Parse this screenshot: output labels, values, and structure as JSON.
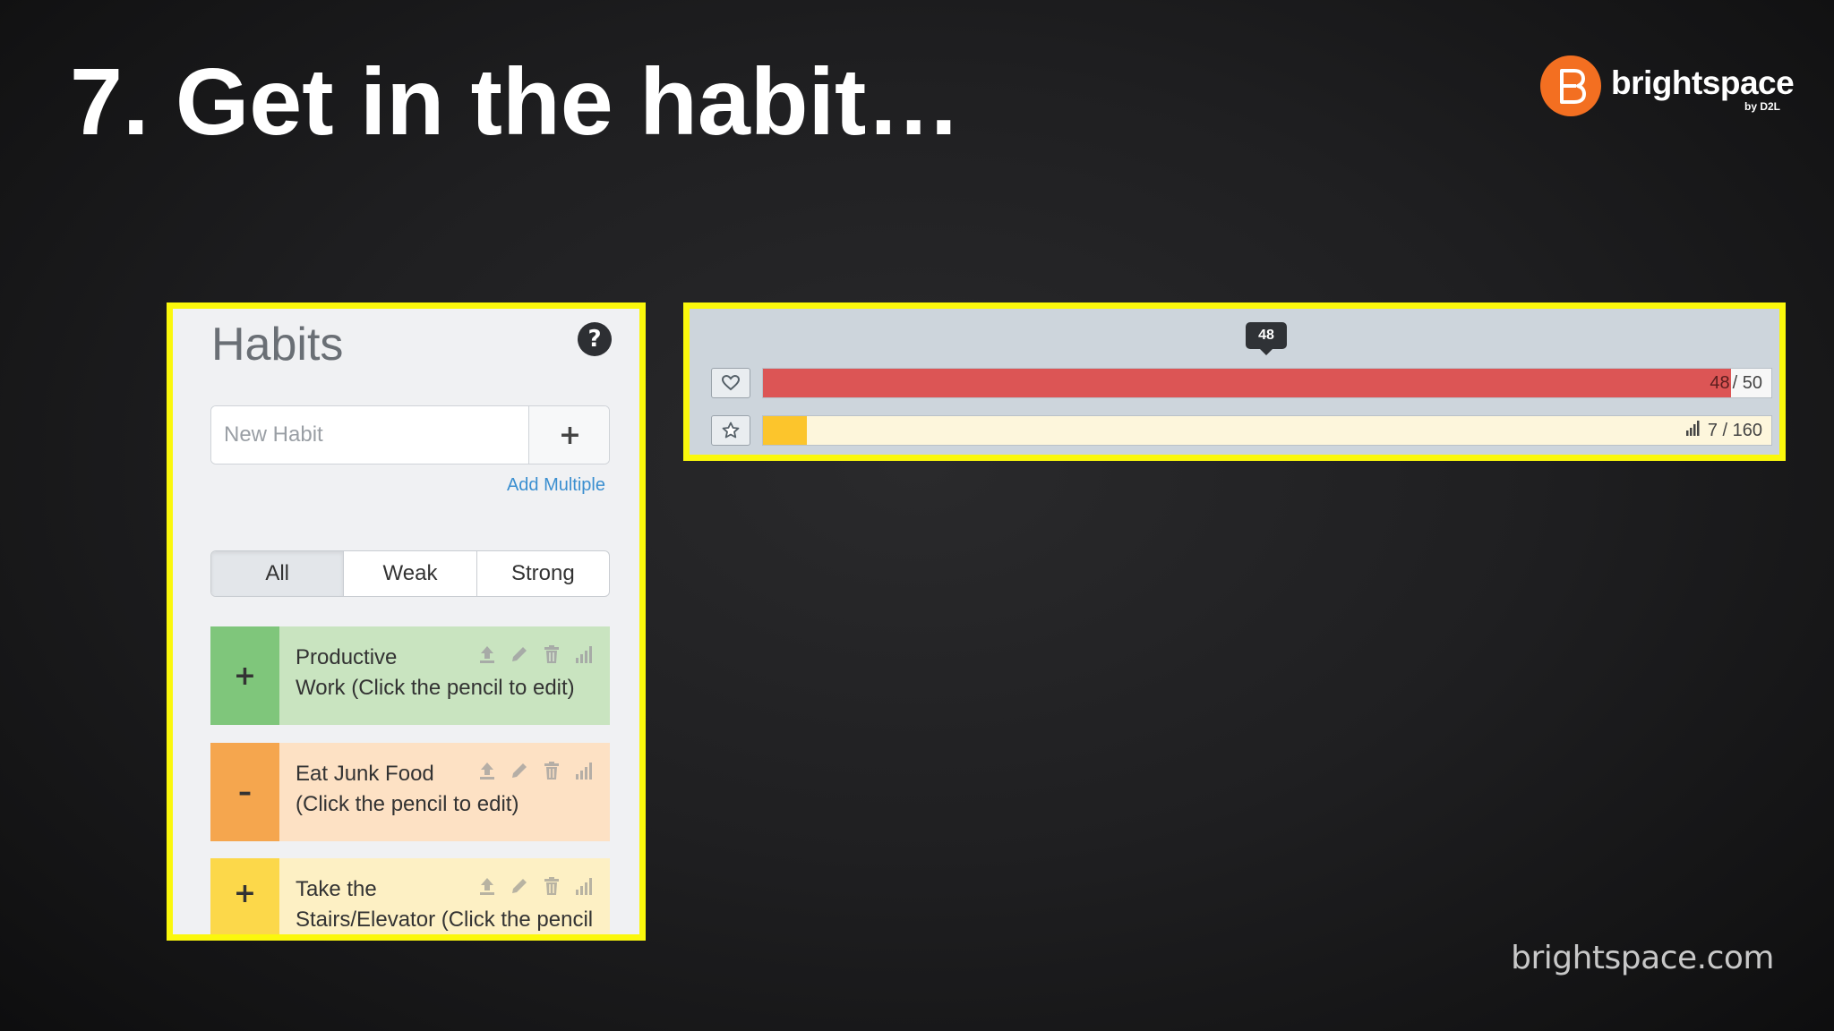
{
  "slide": {
    "title": "7. Get in the habit…",
    "footer_url": "brightspace.com"
  },
  "logo": {
    "word": "brightspace",
    "sub": "by D2L",
    "color": "#f36f21"
  },
  "habits_panel": {
    "title": "Habits",
    "help_icon": "question-circle-icon",
    "new_habit": {
      "value": "",
      "placeholder": "New Habit",
      "add_label": "+"
    },
    "add_multiple_label": "Add Multiple",
    "filters": [
      {
        "label": "All",
        "active": true
      },
      {
        "label": "Weak",
        "active": false
      },
      {
        "label": "Strong",
        "active": false
      }
    ],
    "habits": [
      {
        "button": "+",
        "text_line1": "Productive",
        "text_line2": "Work (Click the pencil to edit)",
        "score_color": "#7fc67b",
        "body_color": "#c9e4c0"
      },
      {
        "button": "–",
        "text_line1": "Eat Junk Food",
        "text_line2": "(Click the pencil to edit)",
        "score_color": "#f5a64e",
        "body_color": "#fde1c4"
      },
      {
        "button": "+",
        "text_line1": "Take the",
        "text_line2": "Stairs/Elevator (Click the pencil",
        "score_color": "#fcd84a",
        "body_color": "#fdf0c4"
      }
    ],
    "habit_action_icons": [
      "upload-icon",
      "pencil-icon",
      "trash-icon",
      "bar-chart-icon"
    ]
  },
  "stats_panel": {
    "health": {
      "icon": "heart-icon",
      "value": 48,
      "max": 50,
      "current_label": "48",
      "sep_label": "/ 50",
      "tooltip": "48",
      "fill_color": "#dc5555",
      "track_color": "#f7f7f7"
    },
    "experience": {
      "icon": "star-icon",
      "value": 7,
      "max": 160,
      "label": "7 / 160",
      "fill_color": "#fcc52c",
      "track_color": "#fdf6dc"
    }
  }
}
